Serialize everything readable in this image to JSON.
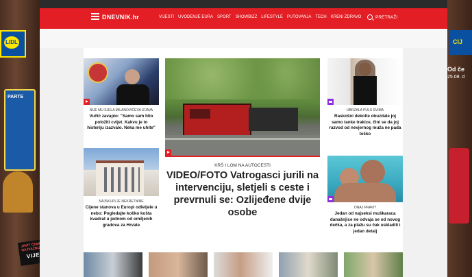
{
  "topbar": {
    "logo": "DNEVNIK.hr",
    "nav": [
      "VIJESTI",
      "UVODENJE EURA",
      "SPORT",
      "SHOWBIZZ",
      "LIFESTYLE",
      "PUTOVANJA",
      "TECH",
      "KRENI ZDRAVO"
    ],
    "search_label": "PRETRAŽI"
  },
  "ads": {
    "left_logo": "LIDL",
    "left_pack": "PARTE",
    "badge_top": "JAVIT ĆEMO VAM NAJVAŽNIJE",
    "badge_main": "VIJESTI!",
    "right_logo": "CIJ",
    "right_text": "Od če",
    "right_date": "25.08. d"
  },
  "articles": {
    "a1": {
      "kicker": "NIJE MU SJELA MILANOVIĆEVA IZJAVA",
      "headline": "Vučić zavapio: \"Samo sam htio položiti cvijet. Kakvu je to histeriju izazvalo. Neka me uhite\""
    },
    "a2": {
      "kicker": "NAJSKUPLJE NEKRETNINE",
      "headline": "Cijene stanova u Europi odletjele u nebo: Pogledajte koliko košta kvadrat u jednom od omiljenih gradova za Hrvate"
    },
    "main": {
      "kicker": "KRŠ I LOM NA AUTOCESTI",
      "headline": "VIDEO/FOTO Vatrogasci jurili na intervenciju, sletjeli s ceste i prevrnuli se: Ozlijeđene dvije osobe"
    },
    "r1": {
      "kicker": "UBRZALA PULS SVIMA",
      "headline": "Raskošni dekolte obuzdale joj samo tanke trakice, čini se da joj razvod od nevjernog muža ne pada teško"
    },
    "r2": {
      "kicker": "ONAJ PRAVI?",
      "headline": "Jedan od najseksi muškaraca današnjice ne odvaja se od novog dečka, a za plažu su čak uskladili i jedan detalj"
    }
  },
  "colors": {
    "brand": "#e31e24",
    "video": "#e31e24",
    "gallery": "#8e2ee0"
  }
}
